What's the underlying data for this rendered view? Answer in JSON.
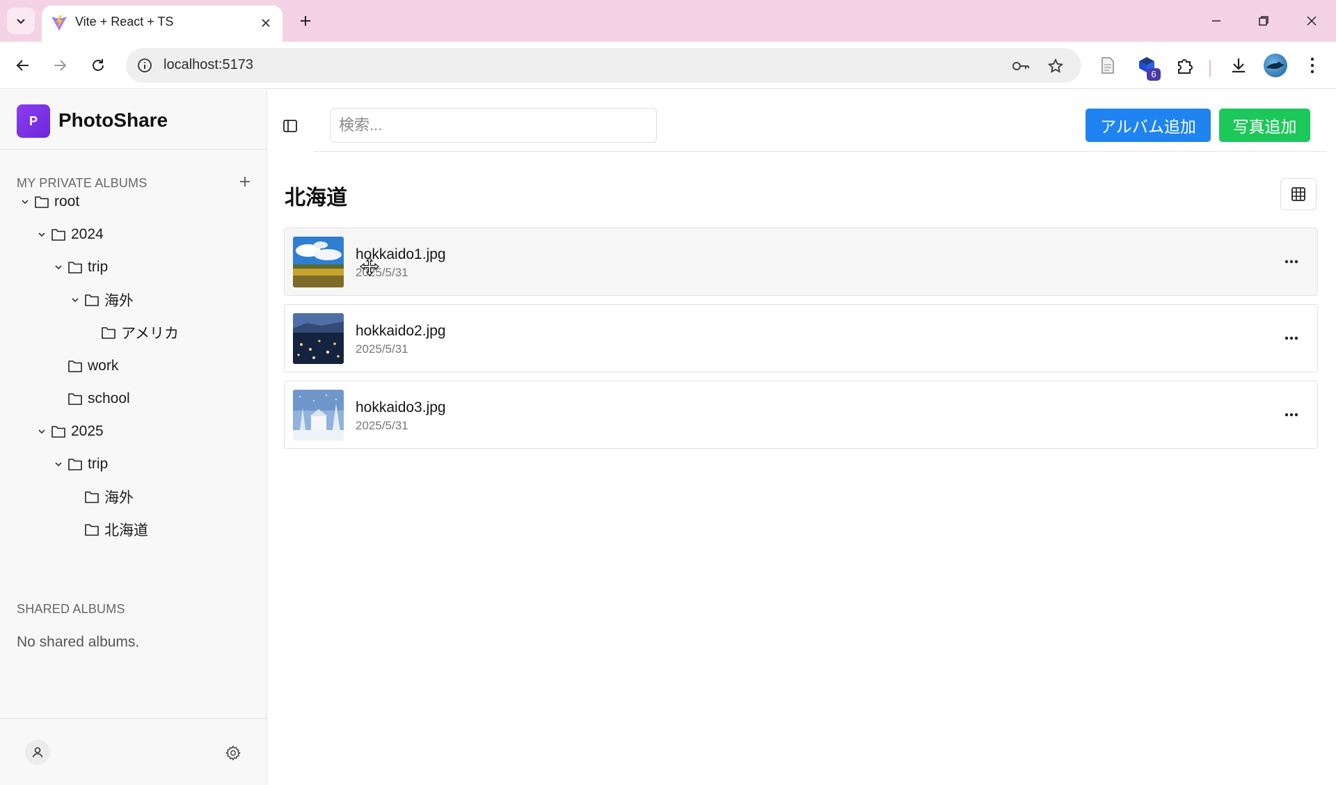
{
  "browser": {
    "tab_title": "Vite + React + TS",
    "url": "localhost:5173",
    "extension_badge": "6"
  },
  "app": {
    "logo_letter": "P",
    "name": "PhotoShare"
  },
  "sidebar": {
    "private_label": "MY PRIVATE ALBUMS",
    "tree": [
      {
        "label": "root",
        "depth": 0,
        "expanded": true
      },
      {
        "label": "2024",
        "depth": 1,
        "expanded": true
      },
      {
        "label": "trip",
        "depth": 2,
        "expanded": true
      },
      {
        "label": "海外",
        "depth": 3,
        "expanded": true
      },
      {
        "label": "アメリカ",
        "depth": 4,
        "expanded": false
      },
      {
        "label": "work",
        "depth": 2,
        "expanded": false
      },
      {
        "label": "school",
        "depth": 2,
        "expanded": false
      },
      {
        "label": "2025",
        "depth": 1,
        "expanded": true
      },
      {
        "label": "trip",
        "depth": 2,
        "expanded": true
      },
      {
        "label": "海外",
        "depth": 3,
        "expanded": false
      },
      {
        "label": "北海道",
        "depth": 3,
        "expanded": false
      }
    ],
    "shared_label": "SHARED ALBUMS",
    "no_shared": "No shared albums."
  },
  "topbar": {
    "search_placeholder": "検索...",
    "add_album_label": "アルバム追加",
    "add_photo_label": "写真追加"
  },
  "album": {
    "title": "北海道",
    "photos": [
      {
        "name": "hokkaido1.jpg",
        "date": "2025/5/31"
      },
      {
        "name": "hokkaido2.jpg",
        "date": "2025/5/31"
      },
      {
        "name": "hokkaido3.jpg",
        "date": "2025/5/31"
      }
    ]
  },
  "colors": {
    "tabbar": "#f4d3e4",
    "primary_button": "#1f84f1",
    "success_button": "#1cc85a",
    "logo": "#7c3aed"
  }
}
